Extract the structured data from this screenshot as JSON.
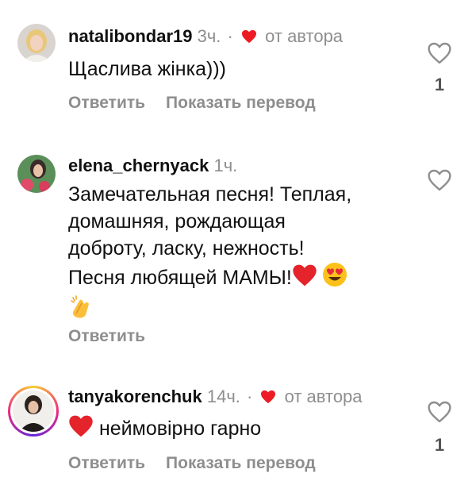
{
  "comments": [
    {
      "username": "natalibondar19",
      "time": "3ч.",
      "separator": "·",
      "author_note": "от автора",
      "text": "Щаслива жінка)))",
      "reply_label": "Ответить",
      "translate_label": "Показать перевод",
      "likes": "1"
    },
    {
      "username": "elena_chernyack",
      "time": "1ч.",
      "text_lines": [
        "Замечательная песня! Теплая,",
        "домашняя, рождающая",
        "доброту, ласку, нежность!",
        "Песня любящей МАМЫ!"
      ],
      "reply_label": "Ответить"
    },
    {
      "username": "tanyakorenchuk",
      "time": "14ч.",
      "separator": "·",
      "author_note": "от автора",
      "text": "неймовірно гарно",
      "reply_label": "Ответить",
      "translate_label": "Показать перевод",
      "likes": "1"
    }
  ],
  "colors": {
    "heart": "#ed1c24",
    "muted": "#8e8e8e"
  },
  "icons": [
    "heart-outline-icon",
    "red-heart-icon",
    "heart-eyes-emoji-icon",
    "clapping-hands-emoji-icon"
  ]
}
